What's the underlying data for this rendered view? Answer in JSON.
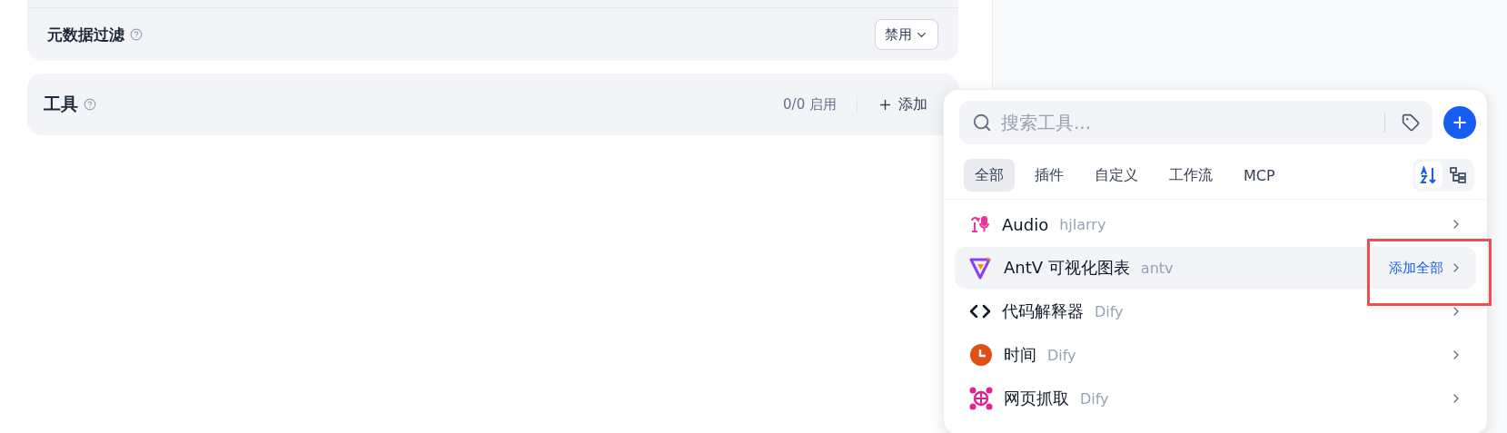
{
  "metadata_filter": {
    "label": "元数据过滤",
    "value": "禁用"
  },
  "tools": {
    "label": "工具",
    "count": "0/0 启用",
    "add": "添加"
  },
  "tool_picker": {
    "search": {
      "placeholder": "搜索工具..."
    },
    "tabs": [
      {
        "label": "全部",
        "selected": true
      },
      {
        "label": "插件",
        "selected": false
      },
      {
        "label": "自定义",
        "selected": false
      },
      {
        "label": "工作流",
        "selected": false
      },
      {
        "label": "MCP",
        "selected": false
      }
    ],
    "view_toggle": [
      {
        "kind": "sort",
        "selected": true
      },
      {
        "kind": "tree",
        "selected": false
      }
    ],
    "providers": [
      {
        "kind": "audio",
        "name": "Audio",
        "author": "hjlarry",
        "hovered": false
      },
      {
        "kind": "antv",
        "name": "AntV 可视化图表",
        "author": "antv",
        "hovered": true,
        "action": "添加全部",
        "highlighted": true
      },
      {
        "kind": "code",
        "name": "代码解释器",
        "author": "Dify",
        "hovered": false
      },
      {
        "kind": "time",
        "name": "时间",
        "author": "Dify",
        "hovered": false
      },
      {
        "kind": "web",
        "name": "网页抓取",
        "author": "Dify",
        "hovered": false
      }
    ]
  }
}
